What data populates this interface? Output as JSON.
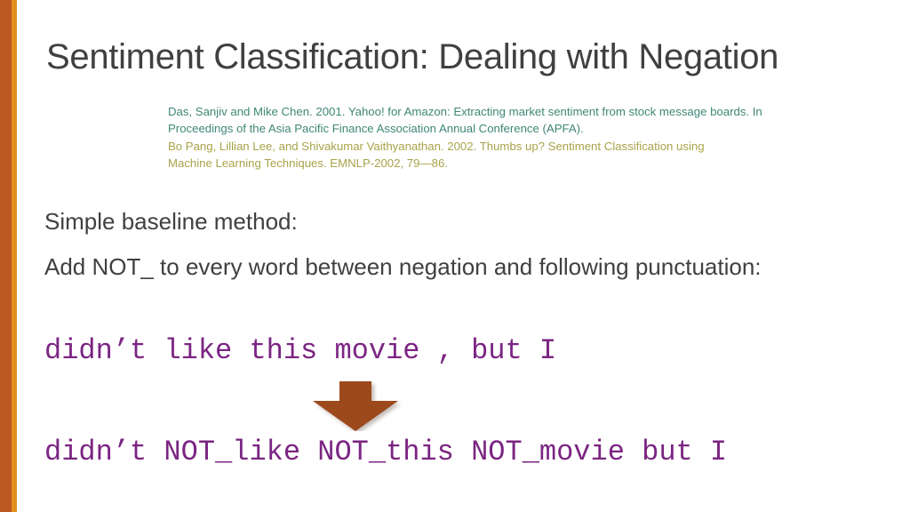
{
  "slide": {
    "title": "Sentiment Classification: Dealing with Negation",
    "watermark": "",
    "accent_colors": {
      "stripe_wide": "#bd5825",
      "stripe_thin": "#e0901d",
      "citation_teal": "#3f8777",
      "citation_olive": "#a8a44a",
      "code_purple": "#7b2583",
      "arrow_brown": "#9c4a1e",
      "title_gray": "#404040"
    }
  },
  "citations": [
    {
      "id": "das-chen-2001",
      "color_key": "citation_teal",
      "lines": [
        "Das, Sanjiv and Mike Chen. 2001. Yahoo! for Amazon: Extracting market sentiment from stock message boards. In",
        "Proceedings of the Asia Pacific Finance Association Annual Conference (APFA)."
      ]
    },
    {
      "id": "pang-lee-vaithyanathan-2002",
      "color_key": "citation_olive",
      "lines": [
        "Bo Pang, Lillian Lee, and Shivakumar Vaithyanathan.  2002.  Thumbs up? Sentiment Classification using",
        "Machine Learning Techniques. EMNLP-2002, 79—86."
      ]
    }
  ],
  "body": {
    "line1": "Simple baseline method:",
    "line2": "Add NOT_ to every word between negation and following punctuation:"
  },
  "example": {
    "before": "didn’t like this movie , but I",
    "after": "didn’t NOT_like NOT_this NOT_movie but I",
    "arrow_direction": "down"
  }
}
